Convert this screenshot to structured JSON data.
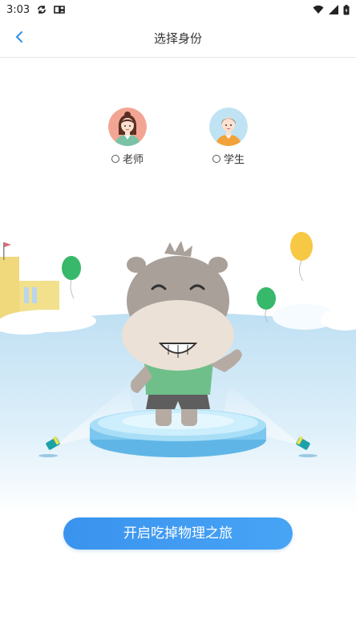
{
  "status_bar": {
    "time": "3:03",
    "icons": [
      "sync-icon",
      "app-notification-icon",
      "wifi-icon",
      "signal-icon",
      "battery-icon"
    ]
  },
  "nav": {
    "back_icon": "chevron-left-icon",
    "title": "选择身份"
  },
  "roles": [
    {
      "label": "老师",
      "avatar": "teacher-avatar",
      "selected": false
    },
    {
      "label": "学生",
      "avatar": "student-avatar",
      "selected": false
    }
  ],
  "start_button": {
    "label": "开启吃掉物理之旅"
  },
  "colors": {
    "accent": "#3a93ee",
    "teacher_avatar_bg": "#f3a594",
    "student_avatar_bg": "#bfe3f2",
    "sky_blue": "#cfe8f6"
  }
}
